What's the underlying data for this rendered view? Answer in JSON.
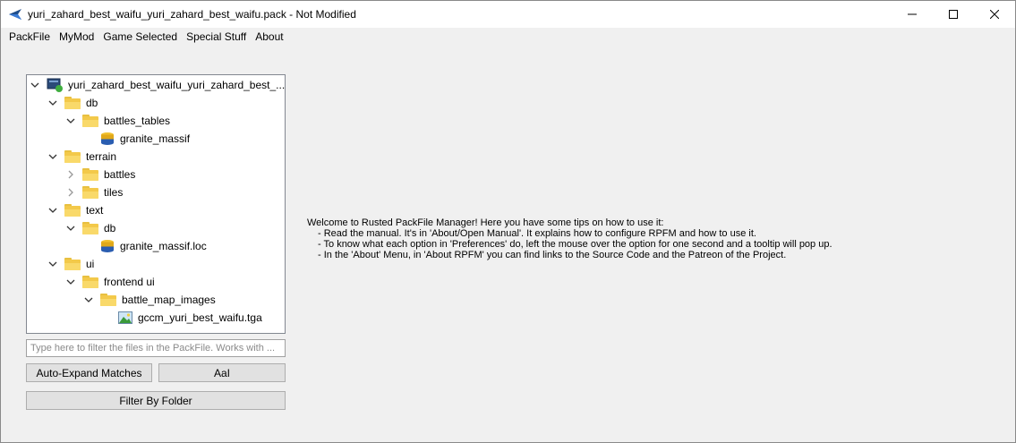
{
  "window": {
    "title": "yuri_zahard_best_waifu_yuri_zahard_best_waifu.pack - Not Modified",
    "minimize_symbol": "—",
    "maximize_symbol": "☐",
    "close_symbol": "✕"
  },
  "menu": {
    "items": [
      {
        "label": "PackFile"
      },
      {
        "label": "MyMod"
      },
      {
        "label": "Game Selected"
      },
      {
        "label": "Special Stuff"
      },
      {
        "label": "About"
      }
    ]
  },
  "tree": {
    "rows": [
      {
        "label": "yuri_zahard_best_waifu_yuri_zahard_best_...",
        "icon": "pack-icon",
        "expanded": true
      },
      {
        "label": "db",
        "icon": "folder-icon",
        "expanded": true
      },
      {
        "label": "battles_tables",
        "icon": "folder-icon",
        "expanded": true
      },
      {
        "label": "granite_massif",
        "icon": "db-table-icon"
      },
      {
        "label": "terrain",
        "icon": "folder-icon",
        "expanded": true
      },
      {
        "label": "battles",
        "icon": "folder-icon",
        "expanded": false
      },
      {
        "label": "tiles",
        "icon": "folder-icon",
        "expanded": false
      },
      {
        "label": "text",
        "icon": "folder-icon",
        "expanded": true
      },
      {
        "label": "db",
        "icon": "folder-icon",
        "expanded": true
      },
      {
        "label": "granite_massif.loc",
        "icon": "db-table-icon"
      },
      {
        "label": "ui",
        "icon": "folder-icon",
        "expanded": true
      },
      {
        "label": "frontend ui",
        "icon": "folder-icon",
        "expanded": true
      },
      {
        "label": "battle_map_images",
        "icon": "folder-icon",
        "expanded": true
      },
      {
        "label": "gccm_yuri_best_waifu.tga",
        "icon": "image-file-icon"
      }
    ]
  },
  "filter": {
    "placeholder": "Type here to filter the files in the PackFile. Works with ...",
    "value": ""
  },
  "buttons": {
    "auto_expand": "Auto-Expand Matches",
    "case_sensitive": "AaI",
    "filter_by_folder": "Filter By Folder"
  },
  "welcome": {
    "intro": "Welcome to Rusted PackFile Manager! Here you have some tips on how to use it:",
    "tips": [
      "- Read the manual. It's in 'About/Open Manual'. It explains how to configure RPFM and how to use it.",
      "- To know what each option in 'Preferences' do, left the mouse over the option for one second and a tooltip will pop up.",
      "- In the 'About' Menu, in 'About RPFM' you can find links to the Source Code and the Patreon of the Project."
    ]
  }
}
